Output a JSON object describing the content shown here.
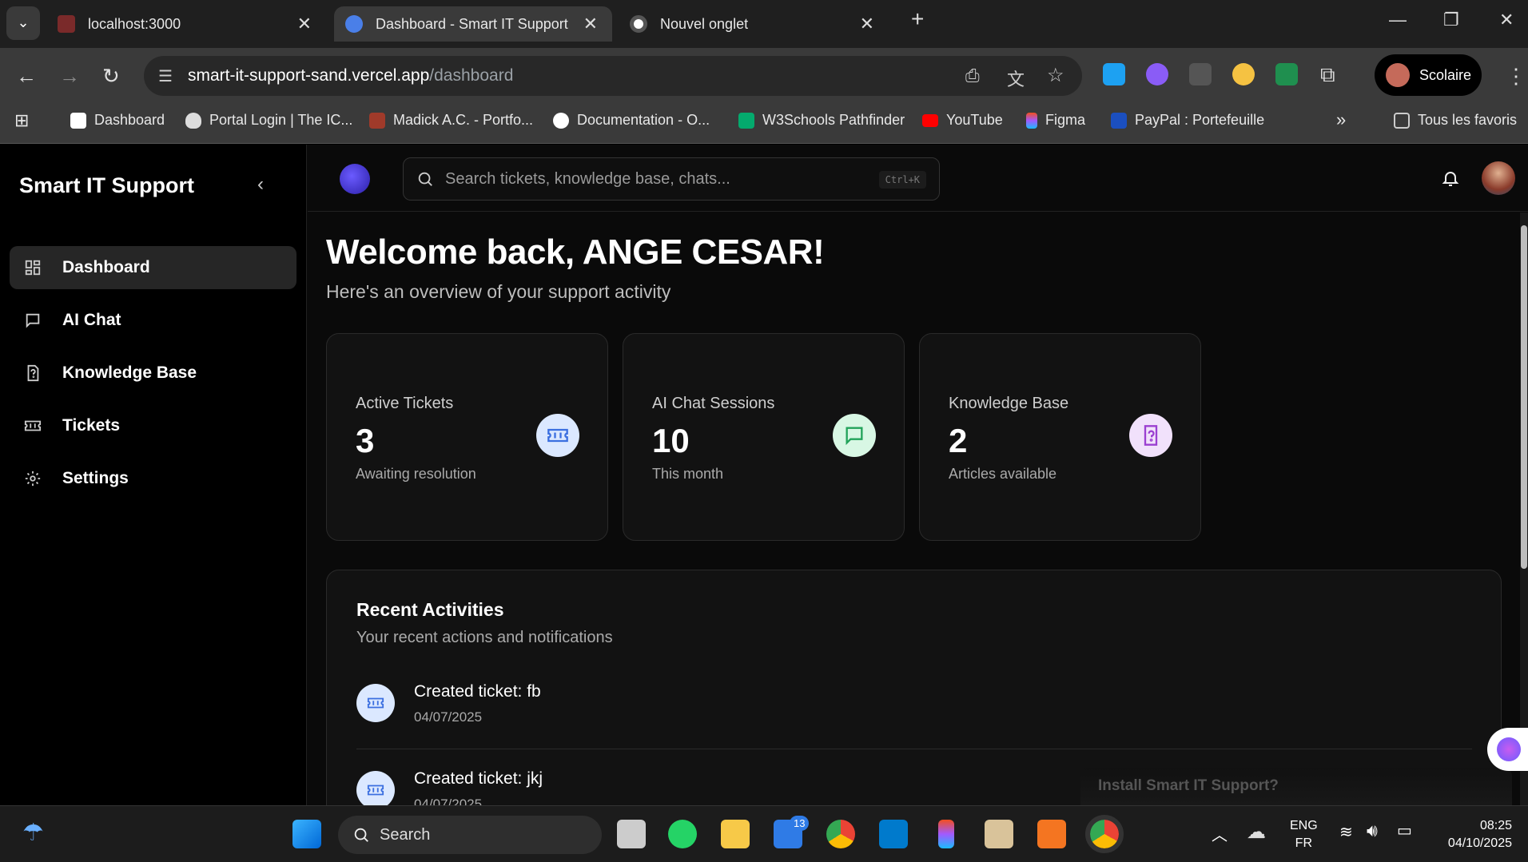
{
  "browser": {
    "tabs": [
      {
        "title": "localhost:3000"
      },
      {
        "title": "Dashboard - Smart IT Support"
      },
      {
        "title": "Nouvel onglet"
      }
    ],
    "url_domain": "smart-it-support-sand.vercel.app",
    "url_path": "/dashboard",
    "profile_name": "Scolaire",
    "bookmarks": [
      "Dashboard",
      "Portal Login | The IC...",
      "Madick A.C. - Portfo...",
      "Documentation - O...",
      "W3Schools Pathfinder",
      "YouTube",
      "Figma",
      "PayPal : Portefeuille"
    ],
    "all_bookmarks": "Tous les favoris",
    "tab_controls": {
      "close": "✕",
      "new_tab": "+",
      "expand": "⌄",
      "bookmarks_overflow": "»"
    },
    "window_controls": {
      "minimize": "—",
      "restore": "❐",
      "close": "✕"
    }
  },
  "app": {
    "brand": "Smart IT Support",
    "nav": [
      {
        "label": "Dashboard",
        "icon": "grid-icon",
        "active": true
      },
      {
        "label": "AI Chat",
        "icon": "chat-icon",
        "active": false
      },
      {
        "label": "Knowledge Base",
        "icon": "help-doc-icon",
        "active": false
      },
      {
        "label": "Tickets",
        "icon": "ticket-icon",
        "active": false
      },
      {
        "label": "Settings",
        "icon": "gear-icon",
        "active": false
      }
    ],
    "search_placeholder": "Search tickets, knowledge base, chats...",
    "search_shortcut": "Ctrl+K",
    "welcome": "Welcome back, ANGE CESAR!",
    "subtitle": "Here's an overview of your support activity",
    "cards": [
      {
        "title": "Active Tickets",
        "value": "3",
        "caption": "Awaiting resolution",
        "icon": "ticket-icon",
        "color": "#dbe8ff",
        "ink": "#3b6fe0"
      },
      {
        "title": "AI Chat Sessions",
        "value": "10",
        "caption": "This month",
        "icon": "chat-icon",
        "color": "#d8f7e4",
        "ink": "#22a35a"
      },
      {
        "title": "Knowledge Base",
        "value": "2",
        "caption": "Articles available",
        "icon": "help-doc-icon",
        "color": "#f1e1fb",
        "ink": "#9b3fd1"
      }
    ],
    "recent": {
      "title": "Recent Activities",
      "subtitle": "Your recent actions and notifications",
      "items": [
        {
          "text": "Created ticket: fb",
          "date": "04/07/2025"
        },
        {
          "text": "Created ticket: jkj",
          "date": "04/07/2025"
        }
      ]
    },
    "install_prompt": "Install Smart IT Support?"
  },
  "taskbar": {
    "search": "Search",
    "badge": "13",
    "lang_top": "ENG",
    "lang_bottom": "FR",
    "time": "08:25",
    "date": "04/10/2025"
  }
}
